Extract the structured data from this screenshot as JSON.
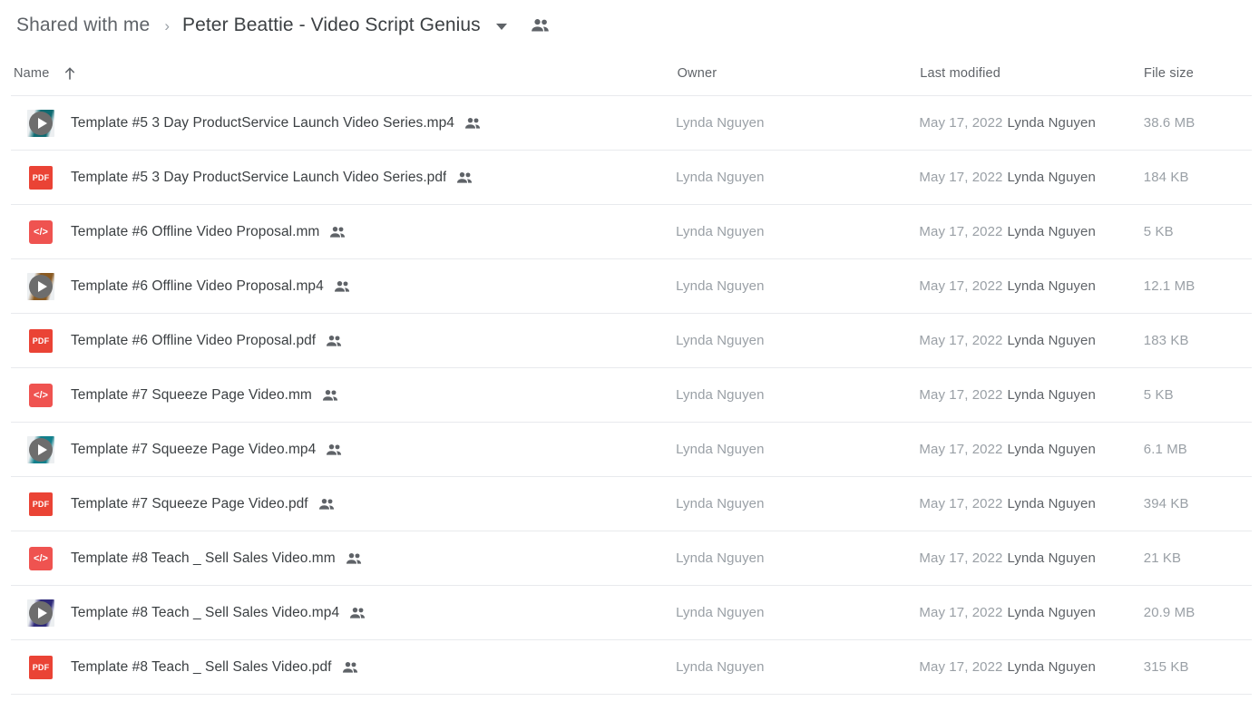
{
  "breadcrumb": {
    "root_label": "Shared with me",
    "separator": "›",
    "current_label": "Peter Beattie - Video Script Genius",
    "caret_icon": "chevron-down-icon",
    "people_icon": "people-shared-icon"
  },
  "columns": {
    "name": "Name",
    "sort_icon": "arrow-up-icon",
    "owner": "Owner",
    "last_modified": "Last modified",
    "file_size": "File size"
  },
  "colors": {
    "pdf_red": "#ea4335",
    "mm_red": "#ef5350",
    "video_gray": "#6d6d6d",
    "text_primary": "#3c4043",
    "text_secondary": "#5f6368",
    "text_muted": "#9aa0a6",
    "divider": "#e8eaed"
  },
  "files": [
    {
      "name": "Template #5 3 Day ProductService Launch Video Series.mp4",
      "icon": "video-file-icon",
      "thumb_tint": "#0f6b72",
      "shared": true,
      "owner": "Lynda Nguyen",
      "modified_date": "May 17, 2022",
      "modified_by": "Lynda Nguyen",
      "size": "38.6 MB"
    },
    {
      "name": "Template #5 3 Day ProductService Launch Video Series.pdf",
      "icon": "pdf-file-icon",
      "icon_label": "PDF",
      "shared": true,
      "owner": "Lynda Nguyen",
      "modified_date": "May 17, 2022",
      "modified_by": "Lynda Nguyen",
      "size": "184 KB"
    },
    {
      "name": "Template #6 Offline Video Proposal.mm",
      "icon": "code-file-icon",
      "icon_label": "</>",
      "shared": true,
      "owner": "Lynda Nguyen",
      "modified_date": "May 17, 2022",
      "modified_by": "Lynda Nguyen",
      "size": "5 KB"
    },
    {
      "name": "Template #6 Offline Video Proposal.mp4",
      "icon": "video-file-icon",
      "thumb_tint": "#8a5a22",
      "shared": true,
      "owner": "Lynda Nguyen",
      "modified_date": "May 17, 2022",
      "modified_by": "Lynda Nguyen",
      "size": "12.1 MB"
    },
    {
      "name": "Template #6 Offline Video Proposal.pdf",
      "icon": "pdf-file-icon",
      "icon_label": "PDF",
      "shared": true,
      "owner": "Lynda Nguyen",
      "modified_date": "May 17, 2022",
      "modified_by": "Lynda Nguyen",
      "size": "183 KB"
    },
    {
      "name": "Template #7 Squeeze Page Video.mm",
      "icon": "code-file-icon",
      "icon_label": "</>",
      "shared": true,
      "owner": "Lynda Nguyen",
      "modified_date": "May 17, 2022",
      "modified_by": "Lynda Nguyen",
      "size": "5 KB"
    },
    {
      "name": "Template #7 Squeeze Page Video.mp4",
      "icon": "video-file-icon",
      "thumb_tint": "#13808c",
      "shared": true,
      "owner": "Lynda Nguyen",
      "modified_date": "May 17, 2022",
      "modified_by": "Lynda Nguyen",
      "size": "6.1 MB"
    },
    {
      "name": "Template #7 Squeeze Page Video.pdf",
      "icon": "pdf-file-icon",
      "icon_label": "PDF",
      "shared": true,
      "owner": "Lynda Nguyen",
      "modified_date": "May 17, 2022",
      "modified_by": "Lynda Nguyen",
      "size": "394 KB"
    },
    {
      "name": "Template #8 Teach _ Sell Sales Video.mm",
      "icon": "code-file-icon",
      "icon_label": "</>",
      "shared": true,
      "owner": "Lynda Nguyen",
      "modified_date": "May 17, 2022",
      "modified_by": "Lynda Nguyen",
      "size": "21 KB"
    },
    {
      "name": "Template #8 Teach _ Sell Sales Video.mp4",
      "icon": "video-file-icon",
      "thumb_tint": "#2f2a7a",
      "shared": true,
      "owner": "Lynda Nguyen",
      "modified_date": "May 17, 2022",
      "modified_by": "Lynda Nguyen",
      "size": "20.9 MB"
    },
    {
      "name": "Template #8 Teach _ Sell Sales Video.pdf",
      "icon": "pdf-file-icon",
      "icon_label": "PDF",
      "shared": true,
      "owner": "Lynda Nguyen",
      "modified_date": "May 17, 2022",
      "modified_by": "Lynda Nguyen",
      "size": "315 KB"
    }
  ]
}
